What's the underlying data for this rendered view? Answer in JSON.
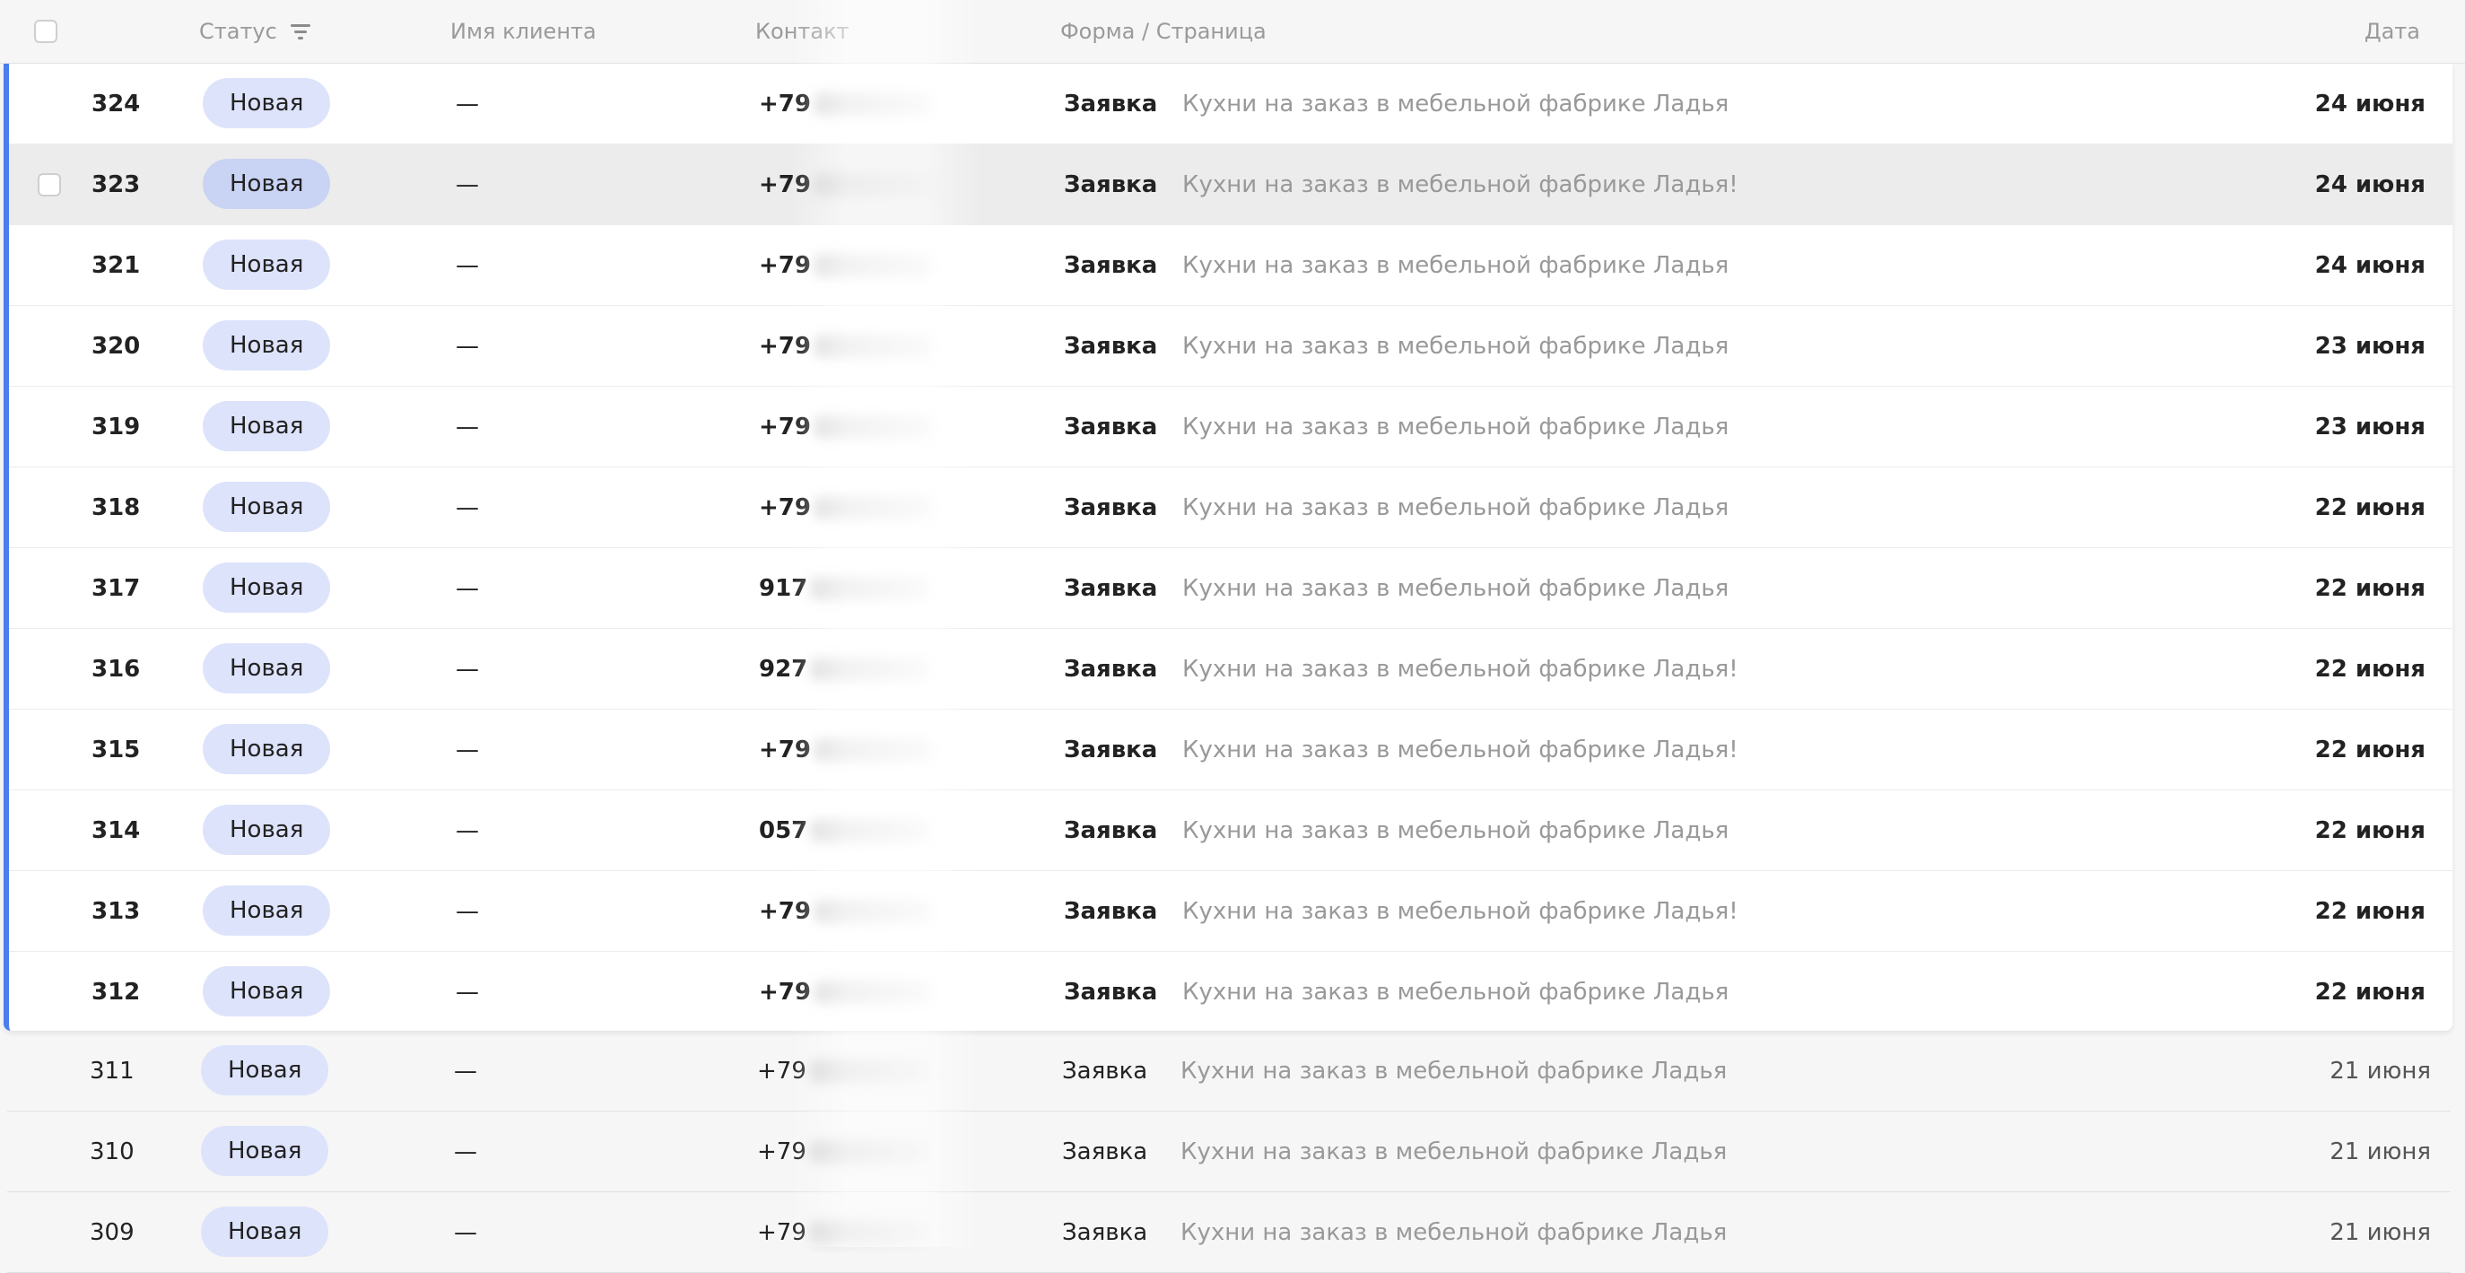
{
  "header": {
    "status": "Статус",
    "client_name": "Имя клиента",
    "contact": "Контакт",
    "form_page": "Форма / Страница",
    "date": "Дата",
    "filter_icon": "filter-icon"
  },
  "rows": [
    {
      "id": "324",
      "status": "Новая",
      "name": "—",
      "contact": "+79",
      "form": "Заявка",
      "page": "Кухни на заказ в мебельной фабрике Ладья",
      "date": "24 июня"
    },
    {
      "id": "323",
      "status": "Новая",
      "name": "—",
      "contact": "+79",
      "form": "Заявка",
      "page": "Кухни на заказ в мебельной фабрике Ладья!",
      "date": "24 июня"
    },
    {
      "id": "321",
      "status": "Новая",
      "name": "—",
      "contact": "+79",
      "form": "Заявка",
      "page": "Кухни на заказ в мебельной фабрике Ладья",
      "date": "24 июня"
    },
    {
      "id": "320",
      "status": "Новая",
      "name": "—",
      "contact": "+79",
      "form": "Заявка",
      "page": "Кухни на заказ в мебельной фабрике Ладья",
      "date": "23 июня"
    },
    {
      "id": "319",
      "status": "Новая",
      "name": "—",
      "contact": "+79",
      "form": "Заявка",
      "page": "Кухни на заказ в мебельной фабрике Ладья",
      "date": "23 июня"
    },
    {
      "id": "318",
      "status": "Новая",
      "name": "—",
      "contact": "+79",
      "form": "Заявка",
      "page": "Кухни на заказ в мебельной фабрике Ладья",
      "date": "22 июня"
    },
    {
      "id": "317",
      "status": "Новая",
      "name": "—",
      "contact": "917",
      "form": "Заявка",
      "page": "Кухни на заказ в мебельной фабрике Ладья",
      "date": "22 июня"
    },
    {
      "id": "316",
      "status": "Новая",
      "name": "—",
      "contact": "927",
      "form": "Заявка",
      "page": "Кухни на заказ в мебельной фабрике Ладья!",
      "date": "22 июня"
    },
    {
      "id": "315",
      "status": "Новая",
      "name": "—",
      "contact": "+79",
      "form": "Заявка",
      "page": "Кухни на заказ в мебельной фабрике Ладья!",
      "date": "22 июня"
    },
    {
      "id": "314",
      "status": "Новая",
      "name": "—",
      "contact": "057",
      "form": "Заявка",
      "page": "Кухни на заказ в мебельной фабрике Ладья",
      "date": "22 июня"
    },
    {
      "id": "313",
      "status": "Новая",
      "name": "—",
      "contact": "+79",
      "form": "Заявка",
      "page": "Кухни на заказ в мебельной фабрике Ладья!",
      "date": "22 июня"
    },
    {
      "id": "312",
      "status": "Новая",
      "name": "—",
      "contact": "+79",
      "form": "Заявка",
      "page": "Кухни на заказ в мебельной фабрике Ладья",
      "date": "22 июня"
    }
  ],
  "rows_below": [
    {
      "id": "311",
      "status": "Новая",
      "name": "—",
      "contact": "+79",
      "form": "Заявка",
      "page": "Кухни на заказ в мебельной фабрике Ладья",
      "date": "21 июня"
    },
    {
      "id": "310",
      "status": "Новая",
      "name": "—",
      "contact": "+79",
      "form": "Заявка",
      "page": "Кухни на заказ в мебельной фабрике Ладья",
      "date": "21 июня"
    },
    {
      "id": "309",
      "status": "Новая",
      "name": "—",
      "contact": "+79",
      "form": "Заявка",
      "page": "Кухни на заказ в мебельной фабрике Ладья",
      "date": "21 июня"
    }
  ],
  "colors": {
    "accent": "#4a7ef0",
    "badge": "#dde3fb",
    "hover_row": "#ebeceb"
  }
}
